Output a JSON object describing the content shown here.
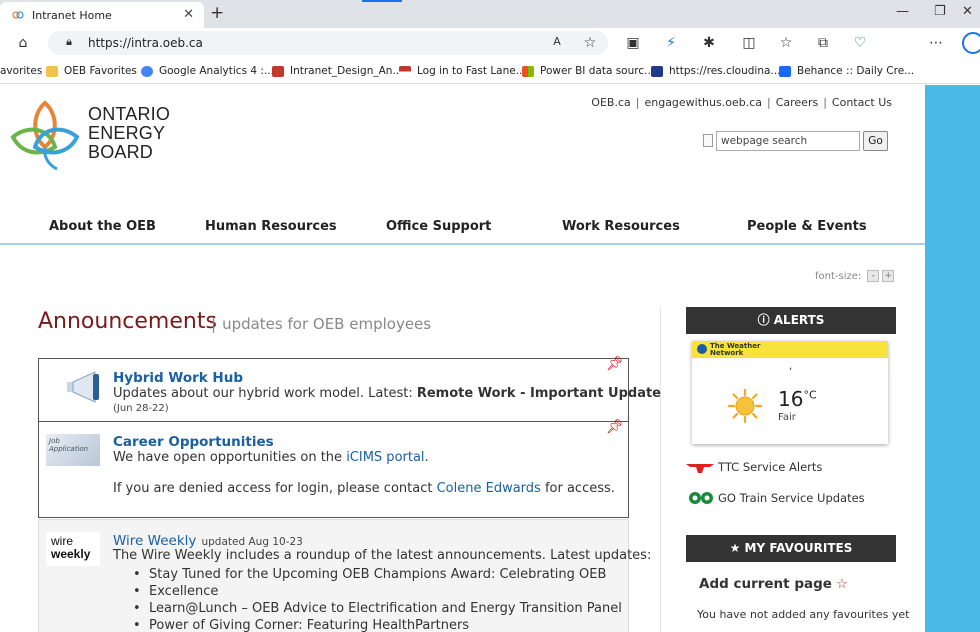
{
  "browser": {
    "tab_title": "Intranet Home",
    "new_tab": "+",
    "tab_close": "✕",
    "url": "https://intra.oeb.ca",
    "bookmarks": [
      "avorites",
      "OEB Favorites",
      "Google Analytics 4 :...",
      "Intranet_Design_An...",
      "Log in to Fast Lane...",
      "Power BI data sourc...",
      "https://res.cloudina...",
      "Behance :: Daily Cre..."
    ]
  },
  "site": {
    "logo_lines": [
      "ONTARIO",
      "ENERGY",
      "BOARD"
    ],
    "top_links": [
      "OEB.ca",
      "engagewithus.oeb.ca",
      "Careers",
      "Contact Us"
    ],
    "top_sep": "|",
    "search_placeholder": "webpage search",
    "search_button": "Go",
    "nav": [
      "About the OEB",
      "Human Resources",
      "Office Support",
      "Work Resources",
      "People & Events"
    ],
    "font_size_label": "font-size:",
    "font_minus": "-",
    "font_plus": "+"
  },
  "announcements": {
    "title": "Announcements",
    "bar": "|",
    "subtitle": "updates for OEB employees",
    "items": [
      {
        "title": "Hybrid Work Hub",
        "text": "Updates about our hybrid work model. Latest: ",
        "bold": "Remote Work - Important Update",
        "date": "(Jun 28-22)"
      },
      {
        "title": "Career Opportunities",
        "thumb_text": "Job Application",
        "text_pre": "We have open opportunities on the ",
        "link": "iCIMS portal",
        "text_post": ".",
        "line2_pre": "If you are denied access for login, please contact ",
        "line2_link": "Colene Edwards",
        "line2_post": " for access."
      },
      {
        "title": "Wire Weekly",
        "thumb_lines": [
          "wire",
          "weekly"
        ],
        "updated": "updated Aug 10-23",
        "text": "The Wire Weekly includes a roundup of the latest announcements. Latest updates:",
        "bullets": [
          "Stay Tuned for the Upcoming OEB Champions Award: Celebrating OEB",
          "Excellence",
          "Learn@Lunch – OEB Advice to Electrification and Energy Transition Panel",
          "Power of Giving Corner: Featuring HealthPartners"
        ]
      }
    ]
  },
  "sidebar": {
    "alerts_title": "ALERTS",
    "weather": {
      "brand_lines": [
        "The Weather",
        "Network"
      ],
      "location": ",",
      "temp": "16",
      "unit": "°C",
      "condition": "Fair"
    },
    "ttc": "TTC Service Alerts",
    "go": "GO Train Service Updates",
    "fav_title": "MY FAVOURITES",
    "fav_add": "Add current page",
    "fav_none": "You have not added any favourites yet"
  }
}
